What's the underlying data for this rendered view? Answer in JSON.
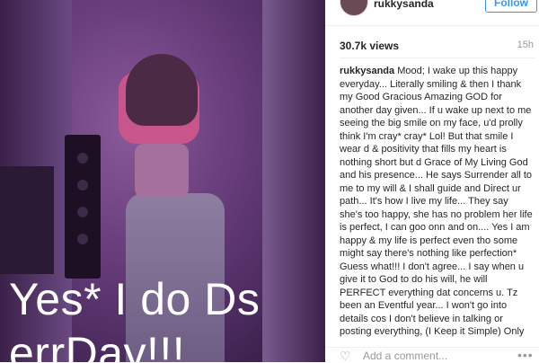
{
  "post": {
    "username": "rukkysanda",
    "follow_label": "Follow",
    "views": "30.7k views",
    "time": "15h",
    "caption_user": "rukkysanda",
    "caption_text": " Mood; I wake up this happy everyday... Literally smiling & then I thank my Good Gracious Amazing GOD for another day given... If u wake up next to me seeing the big smile on my face, u'd prolly think I'm cray* cray* Lol! But that smile I wear d & positivity that fills my heart is nothing short but d Grace of My Living God and his presence... He says Surrender all to me to my will & I shall guide and Direct ur path... It's how I live my life... They say she's too happy, she has no problem her life is perfect, I can goo onn and on.... Yes I am happy & my life is perfect even tho some might say there's nothing like perfection* Guess what!!! I don't agree... I say when u give it to God to do his will, he will PERFECT everything dat concerns u. Tz been an Eventful year... I won't go into details cos I don't believe in talking or posting everything, (I Keep it Simple) Only"
  },
  "media": {
    "overlay_line1": "Yes* I do Ds",
    "overlay_line2": "errDay!!!"
  },
  "comment": {
    "placeholder": "Add a comment...",
    "more_label": "•••"
  },
  "icons": {
    "heart": "heart-icon",
    "more": "more-options-icon"
  },
  "colors": {
    "accent": "#3897f0",
    "muted": "#999999",
    "text": "#262626"
  }
}
